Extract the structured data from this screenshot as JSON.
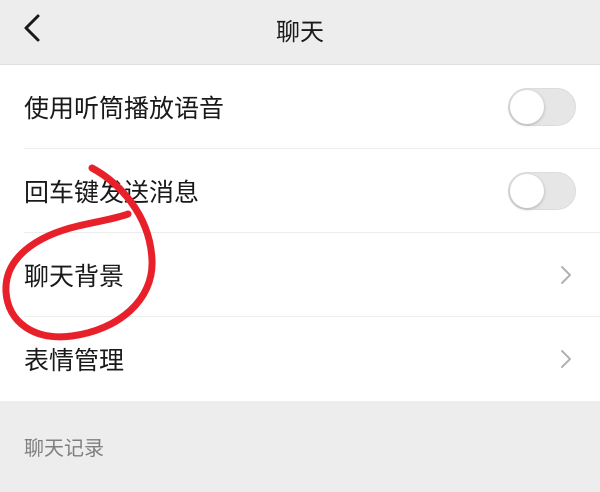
{
  "nav": {
    "title": "聊天",
    "back_icon": "chevron-left-icon"
  },
  "settings": {
    "items": [
      {
        "label": "使用听筒播放语音",
        "control": "switch",
        "on": false
      },
      {
        "label": "回车键发送消息",
        "control": "switch",
        "on": false
      },
      {
        "label": "聊天背景",
        "control": "chevron"
      },
      {
        "label": "表情管理",
        "control": "chevron"
      }
    ]
  },
  "section": {
    "chat_history_label": "聊天记录"
  },
  "colors": {
    "background": "#ededed",
    "cell_background": "#ffffff",
    "annotation": "#e8202a"
  }
}
